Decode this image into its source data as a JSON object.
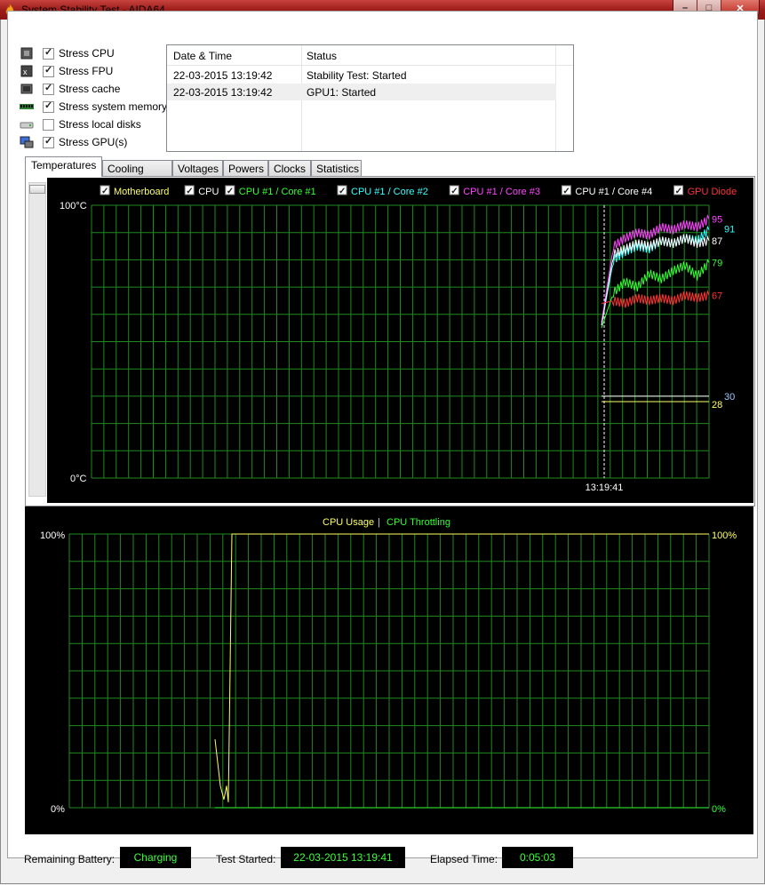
{
  "window": {
    "title": "System Stability Test - AIDA64",
    "app_icon": "aida64-flame-icon"
  },
  "stress_options": [
    {
      "label": "Stress CPU",
      "checked": true,
      "icon": "cpu-icon"
    },
    {
      "label": "Stress FPU",
      "checked": true,
      "icon": "fpu-icon"
    },
    {
      "label": "Stress cache",
      "checked": true,
      "icon": "cache-icon"
    },
    {
      "label": "Stress system memory",
      "checked": true,
      "icon": "memory-icon"
    },
    {
      "label": "Stress local disks",
      "checked": false,
      "icon": "disk-icon"
    },
    {
      "label": "Stress GPU(s)",
      "checked": true,
      "icon": "gpu-icon"
    }
  ],
  "log": {
    "columns": [
      "Date & Time",
      "Status"
    ],
    "rows": [
      {
        "datetime": "22-03-2015 13:19:42",
        "status": "Stability Test: Started"
      },
      {
        "datetime": "22-03-2015 13:19:42",
        "status": "GPU1: Started"
      }
    ]
  },
  "tabs": [
    "Temperatures",
    "Cooling Fans",
    "Voltages",
    "Powers",
    "Clocks",
    "Statistics"
  ],
  "active_tab": "Temperatures",
  "chart_data": [
    {
      "type": "line",
      "ylim": [
        0,
        100
      ],
      "y_top_label": "100°C",
      "y_bottom_label": "0°C",
      "x_marker_label": "13:19:41",
      "legend_placement": "top",
      "grid": true,
      "series": [
        {
          "name": "Motherboard",
          "color": "#ffff66",
          "checked": true,
          "end_value": "28",
          "end_label_color": "#ffff66",
          "values": [
            28,
            28,
            28,
            28,
            28,
            28
          ]
        },
        {
          "name": "CPU",
          "color": "#ffffff",
          "checked": true,
          "end_value": "30",
          "end_label_color": "#9fc7ff",
          "values": [
            30,
            30,
            30,
            30,
            30,
            30
          ]
        },
        {
          "name": "CPU #1 / Core #1",
          "color": "#33ff33",
          "checked": true,
          "end_value": "79",
          "end_label_color": "#33ff33",
          "values": [
            55,
            68,
            72,
            70,
            75,
            73,
            76,
            78,
            74,
            79
          ]
        },
        {
          "name": "CPU #1 / Core #2",
          "color": "#33ffff",
          "checked": true,
          "end_value": "91",
          "end_label_color": "#33ffff",
          "values": [
            56,
            80,
            83,
            85,
            84,
            87,
            86,
            88,
            87,
            91
          ]
        },
        {
          "name": "CPU #1 / Core #3",
          "color": "#ff44ff",
          "checked": true,
          "end_value": "95",
          "end_label_color": "#ff44ff",
          "values": [
            57,
            85,
            88,
            90,
            89,
            92,
            91,
            93,
            92,
            95
          ]
        },
        {
          "name": "CPU #1 / Core #4",
          "color": "#ffffff",
          "checked": true,
          "end_value": "87",
          "end_label_color": "#ffffff",
          "values": [
            56,
            82,
            84,
            86,
            85,
            87,
            86,
            88,
            86,
            87
          ]
        },
        {
          "name": "GPU Diode",
          "color": "#ff3333",
          "checked": true,
          "end_value": "67",
          "end_label_color": "#ff3333",
          "values": [
            64,
            65,
            64,
            66,
            65,
            66,
            65,
            67,
            66,
            67
          ]
        }
      ]
    },
    {
      "type": "line",
      "ylim": [
        0,
        100
      ],
      "y_top_label": "100%",
      "y_bottom_label": "0%",
      "right_top_label": "100%",
      "right_bottom_label": "0%",
      "grid": true,
      "legend": [
        {
          "name": "CPU Usage",
          "color": "#ffff66"
        },
        {
          "name": "CPU Throttling",
          "color": "#33ff33"
        }
      ],
      "series": [
        {
          "name": "CPU Usage",
          "color": "#ffff66",
          "values": [
            25,
            8,
            3,
            8,
            2,
            100,
            100,
            100,
            100,
            100,
            100
          ]
        },
        {
          "name": "CPU Throttling",
          "color": "#33ff33",
          "values": [
            0,
            0,
            0,
            0,
            0,
            0,
            0,
            0,
            0,
            0,
            0
          ]
        }
      ]
    }
  ],
  "status_bar": {
    "battery_label": "Remaining Battery:",
    "battery_value": "Charging",
    "test_started_label": "Test Started:",
    "test_started_value": "22-03-2015 13:19:41",
    "elapsed_label": "Elapsed Time:",
    "elapsed_value": "0:05:03"
  },
  "colors": {
    "grid": "#1f8a1f",
    "chart_bg": "#000000",
    "title_bar": "#9d1d1a",
    "status_value": "#3cff3c"
  }
}
